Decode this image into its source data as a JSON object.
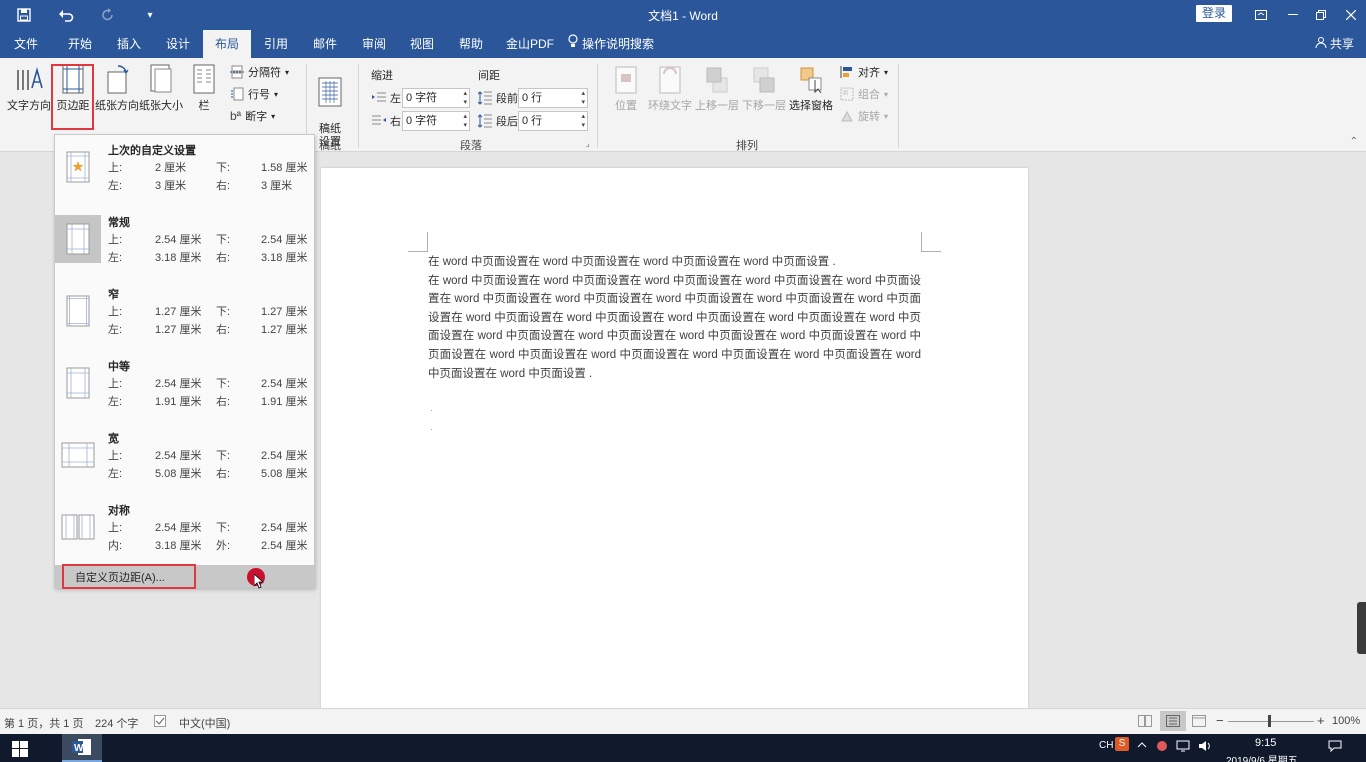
{
  "window": {
    "title": "文档1  -  Word",
    "login_label": "登录"
  },
  "quick_access": {
    "save_icon": "save-icon",
    "undo_icon": "undo-icon",
    "redo_icon": "redo-icon",
    "more_icon": "dropdown-icon"
  },
  "tabs": [
    "文件",
    "开始",
    "插入",
    "设计",
    "布局",
    "引用",
    "邮件",
    "审阅",
    "视图",
    "帮助",
    "金山PDF"
  ],
  "active_tab": "布局",
  "tell_me": "操作说明搜索",
  "share_label": "共享",
  "ribbon": {
    "page_setup": {
      "text_direction": "文字方向",
      "margins": "页边距",
      "orientation": "纸张方向",
      "size": "纸张大小",
      "columns": "栏",
      "breaks": "分隔符",
      "line_numbers": "行号",
      "hyphenation": "断字"
    },
    "draft_paper": {
      "button": "稿纸\n设置",
      "label": "稿纸"
    },
    "paragraph": {
      "indent_header": "缩进",
      "spacing_header": "间距",
      "indent_left_label": "左:",
      "indent_left_value": "0 字符",
      "indent_right_label": "右:",
      "indent_right_value": "0 字符",
      "space_before_label": "段前:",
      "space_before_value": "0 行",
      "space_after_label": "段后:",
      "space_after_value": "0 行",
      "label": "段落"
    },
    "arrange": {
      "position": "位置",
      "wrap_text": "环绕文字",
      "bring_forward": "上移一层",
      "send_backward": "下移一层",
      "selection_pane": "选择窗格",
      "align": "对齐",
      "group": "组合",
      "rotate": "旋转",
      "label": "排列"
    }
  },
  "margins_menu": {
    "options": [
      {
        "name": "上次的自定义设置",
        "l1": "上:",
        "v1": "2 厘米",
        "l2": "下:",
        "v2": "1.58 厘米",
        "l3": "左:",
        "v3": "3 厘米",
        "l4": "右:",
        "v4": "3 厘米"
      },
      {
        "name": "常规",
        "l1": "上:",
        "v1": "2.54 厘米",
        "l2": "下:",
        "v2": "2.54 厘米",
        "l3": "左:",
        "v3": "3.18 厘米",
        "l4": "右:",
        "v4": "3.18 厘米"
      },
      {
        "name": "窄",
        "l1": "上:",
        "v1": "1.27 厘米",
        "l2": "下:",
        "v2": "1.27 厘米",
        "l3": "左:",
        "v3": "1.27 厘米",
        "l4": "右:",
        "v4": "1.27 厘米"
      },
      {
        "name": "中等",
        "l1": "上:",
        "v1": "2.54 厘米",
        "l2": "下:",
        "v2": "2.54 厘米",
        "l3": "左:",
        "v3": "1.91 厘米",
        "l4": "右:",
        "v4": "1.91 厘米"
      },
      {
        "name": "宽",
        "l1": "上:",
        "v1": "2.54 厘米",
        "l2": "下:",
        "v2": "2.54 厘米",
        "l3": "左:",
        "v3": "5.08 厘米",
        "l4": "右:",
        "v4": "5.08 厘米"
      },
      {
        "name": "对称",
        "l1": "上:",
        "v1": "2.54 厘米",
        "l2": "下:",
        "v2": "2.54 厘米",
        "l3": "内:",
        "v3": "3.18 厘米",
        "l4": "外:",
        "v4": "2.54 厘米"
      }
    ],
    "custom": "自定义页边距(A)..."
  },
  "document": {
    "line1": "在 word 中页面设置在 word 中页面设置在 word 中页面设置在 word 中页面设置 .",
    "paragraph": "在 word 中页面设置在 word 中页面设置在 word 中页面设置在 word 中页面设置在 word 中页面设置在 word 中页面设置在 word 中页面设置在 word 中页面设置在 word 中页面设置在 word 中页面设置在 word 中页面设置在 word 中页面设置在 word 中页面设置在 word 中页面设置在 word 中页面设置在 word 中页面设置在 word 中页面设置在 word 中页面设置在 word 中页面设置在 word 中页面设置在 word 中页面设置在 word 中页面设置在 word 中页面设置在 word 中页面设置在 word 中页面设置在 word 中页面设置 ."
  },
  "status": {
    "page": "第 1 页，共 1 页",
    "words": "224 个字",
    "language": "中文(中国)",
    "zoom": "100%"
  },
  "taskbar": {
    "ime": "CH",
    "time": "9:15",
    "date": "2019/9/6 星期五"
  },
  "colors": {
    "accent": "#2b579a",
    "highlight": "#e0383e"
  }
}
